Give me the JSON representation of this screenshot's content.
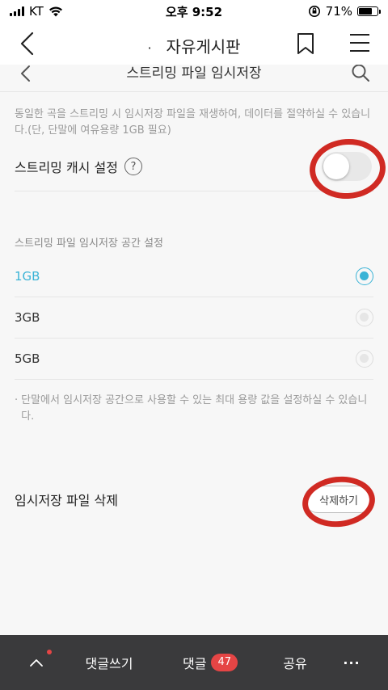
{
  "status_bar": {
    "carrier": "KT",
    "time": "오후 9:52",
    "battery_percent": "71%",
    "battery_level": 0.71
  },
  "top_nav": {
    "title_bullet": "·",
    "title": "자유게시판"
  },
  "settings": {
    "title": "스트리밍 파일 임시저장",
    "description": "동일한 곡을 스트리밍 시 임시저장 파일을 재생하여, 데이터를 절약하실 수 있습니다.(단, 단말에 여유용량 1GB 필요)",
    "cache_label": "스트리밍 캐시 설정",
    "help_symbol": "?",
    "cache_enabled": false,
    "space_section_label": "스트리밍 파일 임시저장 공간 설정",
    "options": [
      {
        "label": "1GB",
        "selected": true
      },
      {
        "label": "3GB",
        "selected": false
      },
      {
        "label": "5GB",
        "selected": false
      }
    ],
    "note_bullet": "·",
    "note": "단말에서 임시저장 공간으로 사용할 수 있는 최대 용량 값을 설정하실 수 있습니다.",
    "delete_label": "임시저장 파일 삭제",
    "delete_button": "삭제하기"
  },
  "bottom_bar": {
    "write_comment": "댓글쓰기",
    "comments": "댓글",
    "comment_count": "47",
    "share": "공유",
    "more": "···"
  },
  "colors": {
    "accent": "#3ab3d6",
    "annotation_red": "#d02a23",
    "bottom_bar_bg": "#3a3a3c",
    "badge": "#e54545"
  }
}
